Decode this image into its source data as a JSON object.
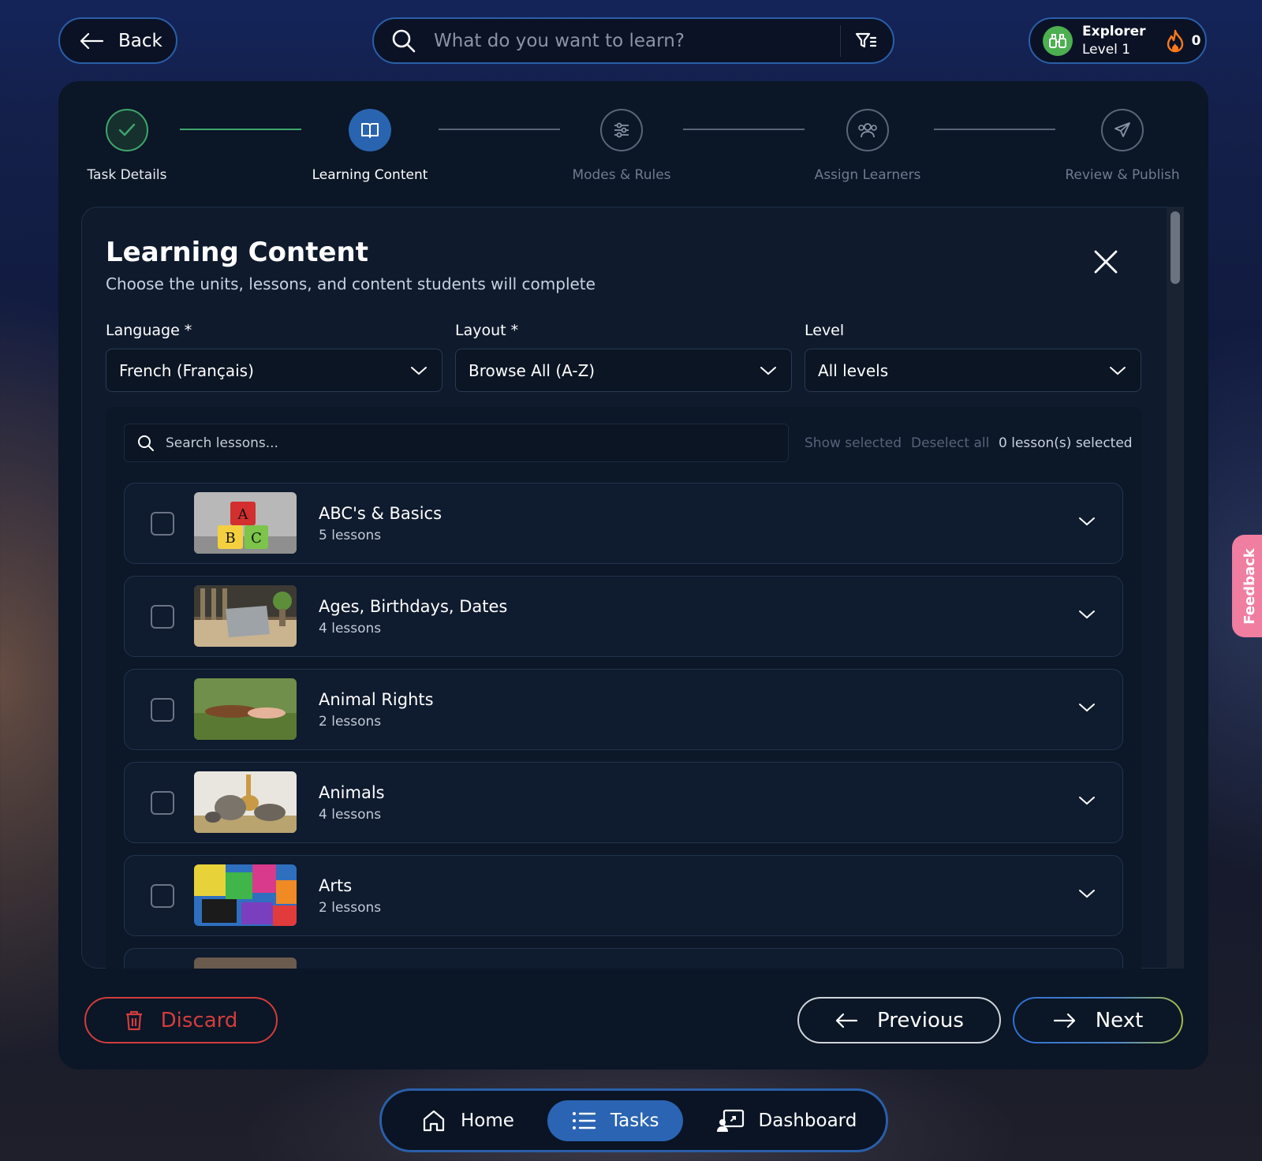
{
  "topbar": {
    "back_label": "Back",
    "search_placeholder": "What do you want to learn?",
    "profile": {
      "title": "Explorer",
      "level": "Level 1",
      "streak": "0"
    }
  },
  "stepper": [
    {
      "label": "Task Details",
      "state": "done",
      "icon": "check-icon"
    },
    {
      "label": "Learning Content",
      "state": "active",
      "icon": "book-icon"
    },
    {
      "label": "Modes & Rules",
      "state": "todo",
      "icon": "sliders-icon"
    },
    {
      "label": "Assign Learners",
      "state": "todo",
      "icon": "users-icon"
    },
    {
      "label": "Review & Publish",
      "state": "todo",
      "icon": "send-icon"
    }
  ],
  "content": {
    "title": "Learning Content",
    "subtitle": "Choose the units, lessons, and content students will complete",
    "fields": {
      "language": {
        "label": "Language *",
        "value": "French (Français)"
      },
      "layout": {
        "label": "Layout *",
        "value": "Browse All (A-Z)"
      },
      "level": {
        "label": "Level",
        "value": "All levels"
      }
    },
    "lesson_search_placeholder": "Search lessons...",
    "show_selected": "Show selected",
    "deselect_all": "Deselect all",
    "selected_count": "0 lesson(s) selected",
    "units": [
      {
        "title": "ABC's & Basics",
        "count": "5 lessons"
      },
      {
        "title": "Ages, Birthdays, Dates",
        "count": "4 lessons"
      },
      {
        "title": "Animal Rights",
        "count": "2 lessons"
      },
      {
        "title": "Animals",
        "count": "4 lessons"
      },
      {
        "title": "Arts",
        "count": "2 lessons"
      }
    ]
  },
  "actions": {
    "discard": "Discard",
    "previous": "Previous",
    "next": "Next"
  },
  "bottom_nav": {
    "home": "Home",
    "tasks": "Tasks",
    "dashboard": "Dashboard"
  },
  "feedback_label": "Feedback",
  "colors": {
    "accent": "#2a64b3",
    "success": "#3fa56b",
    "danger": "#d23d3d",
    "feedback": "#f07ea0"
  }
}
